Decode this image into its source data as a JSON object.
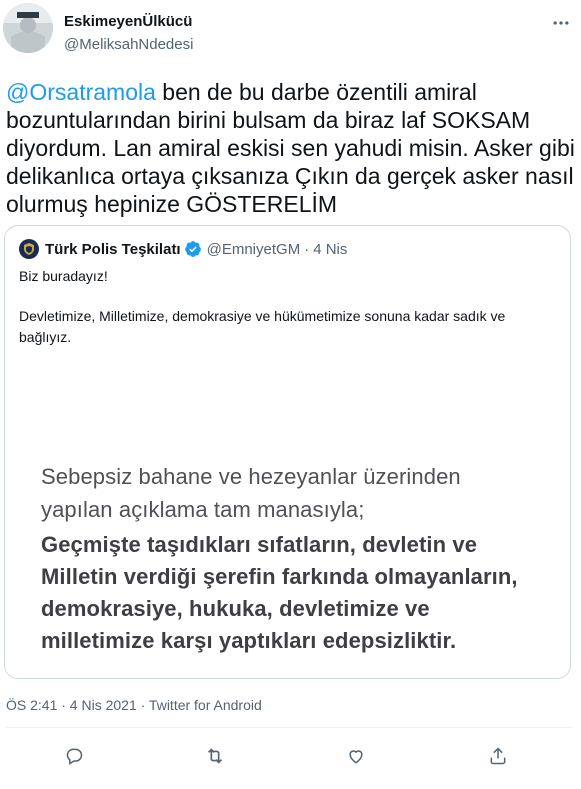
{
  "author": {
    "name": "EskimeyenÜlkücü",
    "handle": "@MeliksahNdedesi"
  },
  "tweet": {
    "mention": "@Orsatramola",
    "text": " ben de bu darbe özentili amiral bozuntularından birini bulsam da biraz laf SOKSAM diyordum. Lan amiral eskisi sen yahudi misin. Asker gibi delikanlıca ortaya çıksanıza Çıkın da gerçek asker nasıl olurmuş hepinize GÖSTERELİM"
  },
  "quote": {
    "name": "Türk Polis Teşkilatı",
    "handle": "@EmniyetGM",
    "dot": "·",
    "date": "4 Nis",
    "line1": "Biz buradayız!",
    "line2": "Devletimize, Milletimize, demokrasiye ve hükümetimize sonuna kadar sadık ve bağlıyız.",
    "image_lines": [
      "Sebepsiz bahane ve hezeyanlar üzerinden",
      "yapılan açıklama tam manasıyla;",
      "Geçmişte taşıdıkları sıfatların, devletin ve",
      "Milletin verdiği şerefin farkında olmayanların,",
      "demokrasiye, hukuka, devletimize ve",
      "milletimize karşı yaptıkları edepsizliktir."
    ]
  },
  "meta": "ÖS 2:41 · 4 Nis 2021 · Twitter for Android",
  "icons": {
    "more": "more-icon",
    "reply": "reply-icon",
    "retweet": "retweet-icon",
    "like": "like-icon",
    "share": "share-icon",
    "verified": "verified-badge-icon"
  },
  "colors": {
    "link": "#1d9bf0",
    "secondary_text": "#536471",
    "primary_text": "#0f1419",
    "border": "#cfd9de"
  }
}
